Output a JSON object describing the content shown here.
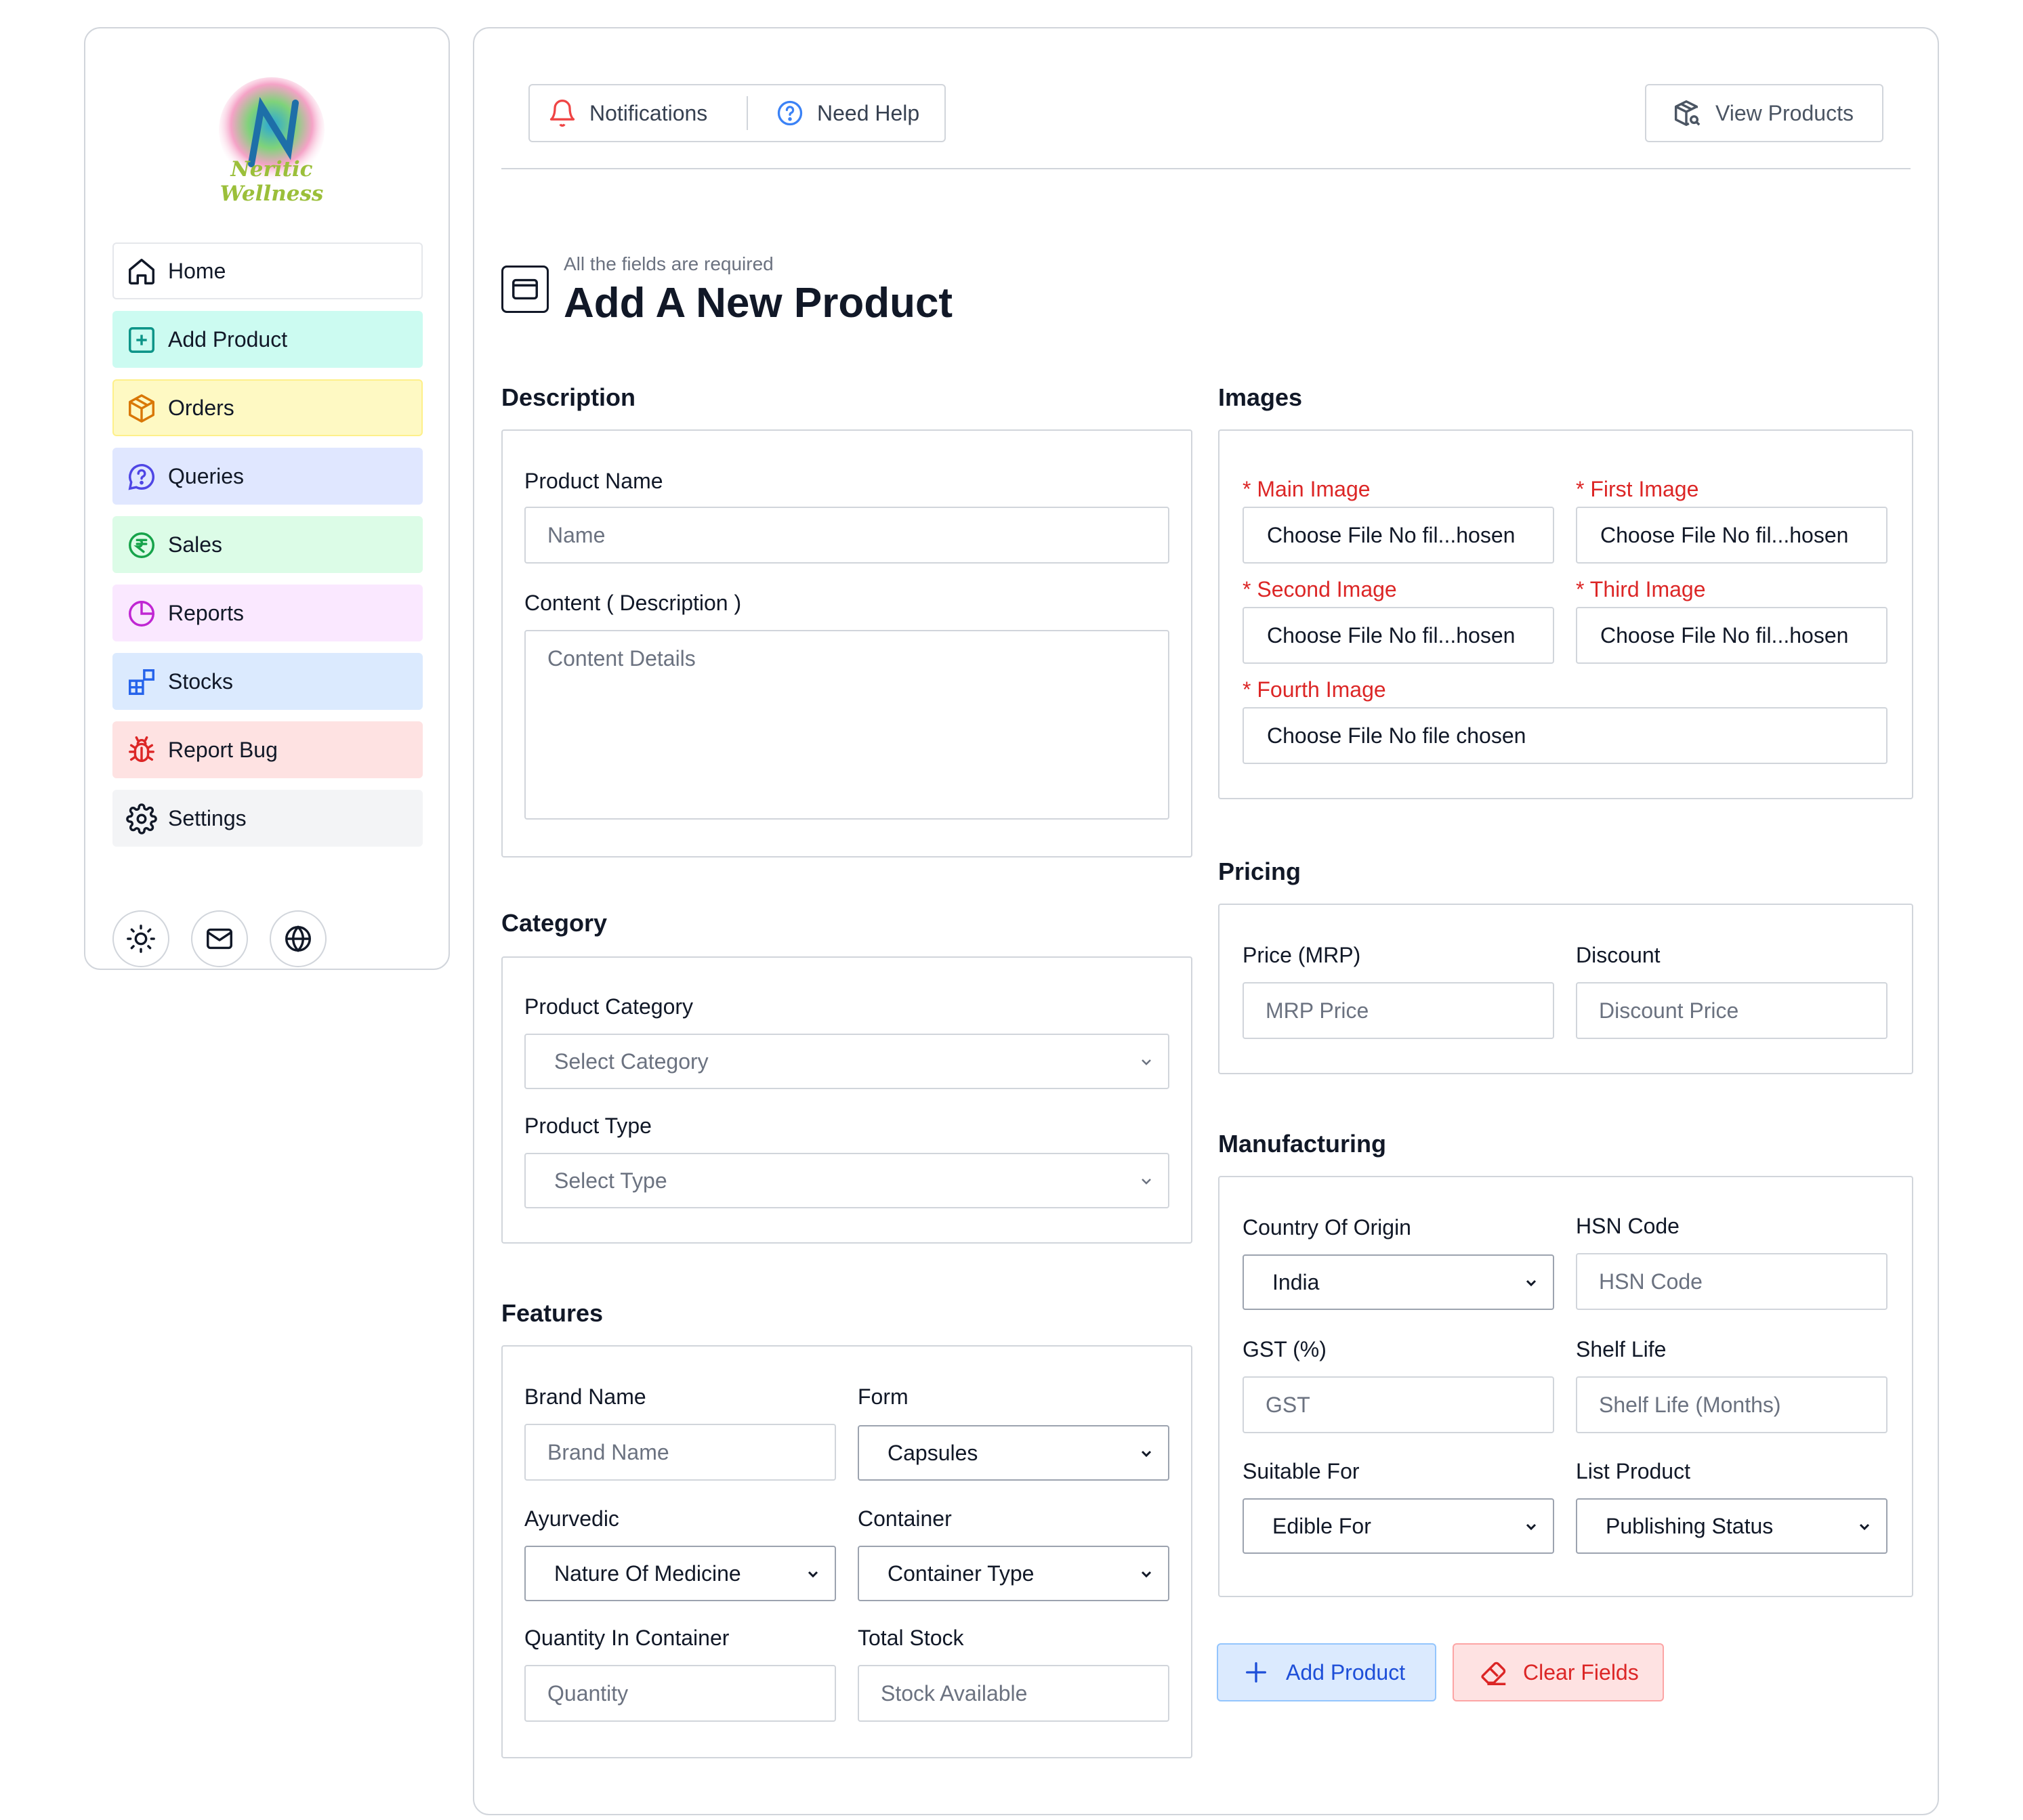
{
  "brand": {
    "name": "Neritic Wellness",
    "logo_icon": "leaf-logo-icon"
  },
  "sidebar": {
    "items": [
      {
        "label": "Home",
        "icon": "home-icon"
      },
      {
        "label": "Add Product",
        "icon": "plus-square-icon"
      },
      {
        "label": "Orders",
        "icon": "package-icon"
      },
      {
        "label": "Queries",
        "icon": "chat-question-icon"
      },
      {
        "label": "Sales",
        "icon": "rupee-icon"
      },
      {
        "label": "Reports",
        "icon": "pie-chart-icon"
      },
      {
        "label": "Stocks",
        "icon": "blocks-icon"
      },
      {
        "label": "Report Bug",
        "icon": "bug-icon"
      },
      {
        "label": "Settings",
        "icon": "gear-icon"
      }
    ],
    "circle_buttons": [
      "sun-icon",
      "mail-icon",
      "globe-icon"
    ]
  },
  "topbar": {
    "notifications": "Notifications",
    "help": "Need Help",
    "view_products": "View Products"
  },
  "page": {
    "subtitle": "All the fields are required",
    "title": "Add A New Product"
  },
  "description": {
    "section": "Description",
    "product_name_label": "Product Name",
    "product_name_placeholder": "Name",
    "content_label": "Content ( Description )",
    "content_placeholder": "Content Details"
  },
  "category": {
    "section": "Category",
    "product_category_label": "Product Category",
    "product_category_value": "Select Category",
    "product_type_label": "Product Type",
    "product_type_value": "Select Type"
  },
  "features": {
    "section": "Features",
    "brand_label": "Brand Name",
    "brand_placeholder": "Brand Name",
    "form_label": "Form",
    "form_value": "Capsules",
    "ayurvedic_label": "Ayurvedic",
    "ayurvedic_value": "Nature Of Medicine",
    "container_label": "Container",
    "container_value": "Container Type",
    "quantity_label": "Quantity In Container",
    "quantity_placeholder": "Quantity",
    "stock_label": "Total Stock",
    "stock_placeholder": "Stock Available"
  },
  "images": {
    "section": "Images",
    "main_label": "* Main Image",
    "main_value": "Choose File No fil...hosen",
    "first_label": "* First Image",
    "first_value": "Choose File No fil...hosen",
    "second_label": "* Second Image",
    "second_value": "Choose File No fil...hosen",
    "third_label": "* Third Image",
    "third_value": "Choose File No fil...hosen",
    "fourth_label": "* Fourth Image",
    "fourth_value": "Choose File No file chosen"
  },
  "pricing": {
    "section": "Pricing",
    "price_label": "Price (MRP)",
    "price_placeholder": "MRP Price",
    "discount_label": "Discount",
    "discount_placeholder": "Discount Price"
  },
  "manufacturing": {
    "section": "Manufacturing",
    "country_label": "Country Of Origin",
    "country_value": "India",
    "hsn_label": "HSN Code",
    "hsn_placeholder": "HSN Code",
    "gst_label": "GST (%)",
    "gst_placeholder": "GST",
    "shelf_label": "Shelf Life",
    "shelf_placeholder": "Shelf Life (Months)",
    "suitable_label": "Suitable For",
    "suitable_value": "Edible For",
    "list_label": "List Product",
    "list_value": "Publishing Status"
  },
  "actions": {
    "add": "Add Product",
    "clear": "Clear Fields"
  },
  "colors": {
    "required": "#dc2626",
    "add_bg": "#dbeafe",
    "clear_bg": "#fee2e2"
  }
}
